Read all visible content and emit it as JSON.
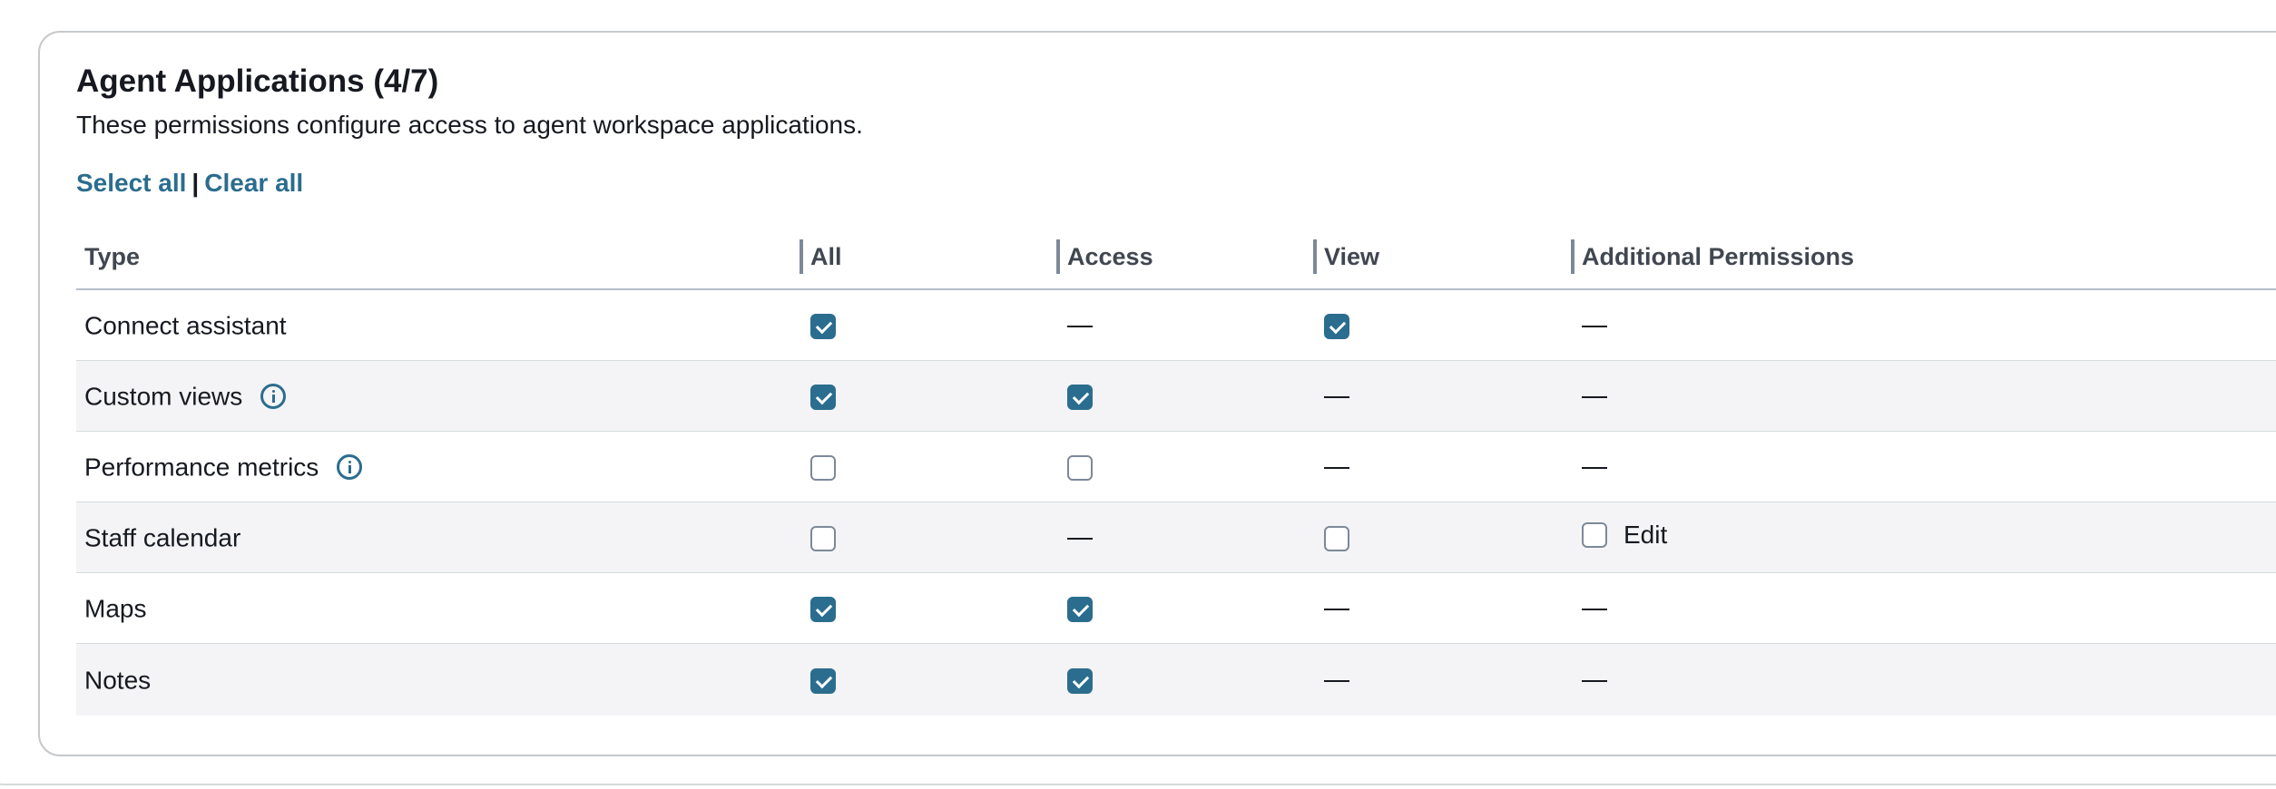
{
  "section": {
    "title": "Agent Applications (4/7)",
    "description": "These permissions configure access to agent workspace applications.",
    "select_all": "Select all",
    "separator": "|",
    "clear_all": "Clear all"
  },
  "table": {
    "headers": [
      "Type",
      "All",
      "Access",
      "View",
      "Additional Permissions"
    ],
    "rows": [
      {
        "type": "Connect assistant",
        "info": false,
        "all": true,
        "access": null,
        "view": true,
        "additional": null
      },
      {
        "type": "Custom views",
        "info": true,
        "all": true,
        "access": true,
        "view": null,
        "additional": null
      },
      {
        "type": "Performance metrics",
        "info": true,
        "all": false,
        "access": false,
        "view": null,
        "additional": null
      },
      {
        "type": "Staff calendar",
        "info": false,
        "all": false,
        "access": null,
        "view": false,
        "additional": {
          "label": "Edit",
          "checked": false
        }
      },
      {
        "type": "Maps",
        "info": false,
        "all": true,
        "access": true,
        "view": null,
        "additional": null
      },
      {
        "type": "Notes",
        "info": false,
        "all": true,
        "access": true,
        "view": null,
        "additional": null
      }
    ]
  },
  "icons": {
    "info": "info-icon",
    "checkbox_checked": "checkbox-checked",
    "checkbox_unchecked": "checkbox-unchecked",
    "not_applicable": "dash"
  },
  "colors": {
    "accent": "#2b6d8e",
    "text": "#16191f",
    "header_text": "#414750",
    "row_alt": "#f4f4f6",
    "border": "#c6c9cc"
  }
}
